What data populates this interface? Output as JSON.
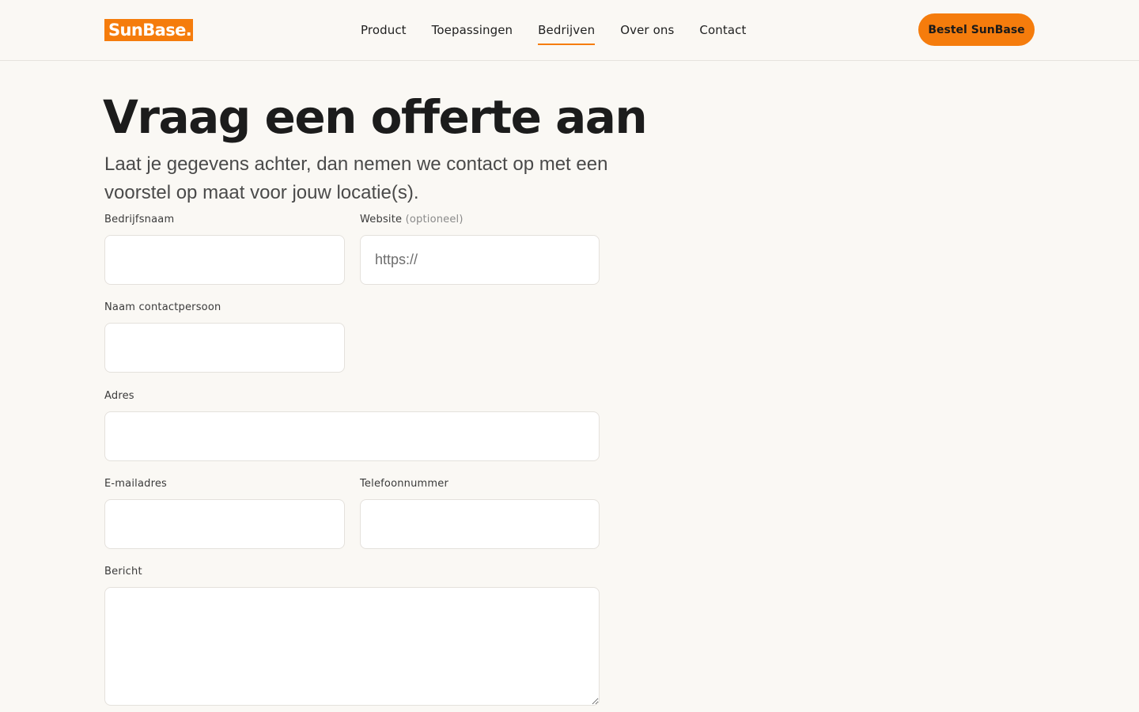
{
  "header": {
    "logo_text": "SunBase.",
    "nav": [
      {
        "label": "Product",
        "active": false
      },
      {
        "label": "Toepassingen",
        "active": false
      },
      {
        "label": "Bedrijven",
        "active": true
      },
      {
        "label": "Over ons",
        "active": false
      },
      {
        "label": "Contact",
        "active": false
      }
    ],
    "cta_label": "Bestel SunBase"
  },
  "main": {
    "title": "Vraag een offerte aan",
    "subtitle": "Laat je gegevens achter, dan nemen we contact op met een voorstel op maat voor jouw locatie(s)."
  },
  "form": {
    "company": {
      "label": "Bedrijfsnaam",
      "value": "",
      "placeholder": ""
    },
    "website": {
      "label": "Website",
      "label_suffix": "(optioneel)",
      "value": "",
      "placeholder": "https://"
    },
    "contact": {
      "label": "Naam contactpersoon",
      "value": "",
      "placeholder": ""
    },
    "address": {
      "label": "Adres",
      "value": "",
      "placeholder": ""
    },
    "email": {
      "label": "E-mailadres",
      "value": "",
      "placeholder": ""
    },
    "phone": {
      "label": "Telefoonnummer",
      "value": "",
      "placeholder": ""
    },
    "message": {
      "label": "Bericht",
      "value": "",
      "placeholder": ""
    }
  },
  "colors": {
    "accent": "#f57c0c",
    "background": "#faf8f4"
  }
}
